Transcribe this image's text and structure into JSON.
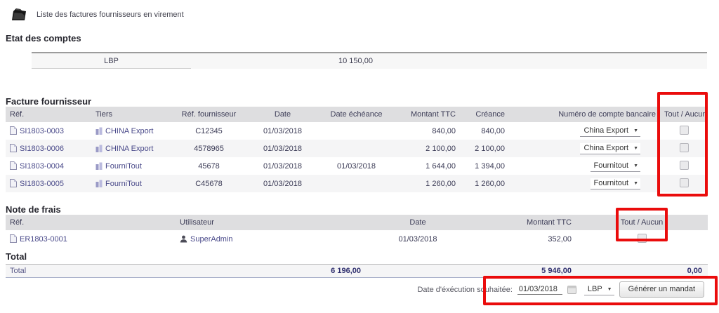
{
  "page": {
    "title": "Liste des factures fournisseurs en virement"
  },
  "accounts": {
    "heading": "Etat des comptes",
    "rows": [
      {
        "label": "LBP",
        "balance": "10 150,00"
      }
    ]
  },
  "supplier_invoices": {
    "heading": "Facture fournisseur",
    "columns": [
      "Réf.",
      "Tiers",
      "Réf. fournisseur",
      "Date",
      "Date échéance",
      "Montant TTC",
      "Créance",
      "Numéro de compte bancaire",
      "Tout / Aucun"
    ],
    "rows": [
      {
        "ref": "SI1803-0003",
        "tiers": "CHINA Export",
        "ref_fournisseur": "C12345",
        "date": "01/03/2018",
        "date_echeance": "",
        "montant_ttc": "840,00",
        "creance": "840,00",
        "compte": "China Export"
      },
      {
        "ref": "SI1803-0006",
        "tiers": "CHINA Export",
        "ref_fournisseur": "4578965",
        "date": "01/03/2018",
        "date_echeance": "",
        "montant_ttc": "2 100,00",
        "creance": "2 100,00",
        "compte": "China Export"
      },
      {
        "ref": "SI1803-0004",
        "tiers": "FourniTout",
        "ref_fournisseur": "45678",
        "date": "01/03/2018",
        "date_echeance": "01/03/2018",
        "montant_ttc": "1 644,00",
        "creance": "1 394,00",
        "compte": "Fournitout"
      },
      {
        "ref": "SI1803-0005",
        "tiers": "FourniTout",
        "ref_fournisseur": "C45678",
        "date": "01/03/2018",
        "date_echeance": "",
        "montant_ttc": "1 260,00",
        "creance": "1 260,00",
        "compte": "Fournitout"
      }
    ]
  },
  "expense_reports": {
    "heading": "Note de frais",
    "columns": [
      "Réf.",
      "Utilisateur",
      "Date",
      "Montant TTC",
      "Tout / Aucun"
    ],
    "rows": [
      {
        "ref": "ER1803-0001",
        "user": "SuperAdmin",
        "date": "01/03/2018",
        "montant_ttc": "352,00"
      }
    ]
  },
  "totals": {
    "heading": "Total",
    "label": "Total",
    "montant_ttc": "6 196,00",
    "creance": "5 946,00",
    "selected": "0,00"
  },
  "action_bar": {
    "date_label": "Date d'éxécution souhaitée:",
    "date_value": "01/03/2018",
    "account_selected": "LBP",
    "generate_button": "Générer un mandat"
  },
  "icons": {
    "dropdown_arrow": "▼"
  },
  "colors": {
    "highlight_red": "#ea0c0c",
    "header_bg": "#dedee0",
    "link": "#4a4a8a",
    "row_alt_bg": "#f5f5f6"
  }
}
